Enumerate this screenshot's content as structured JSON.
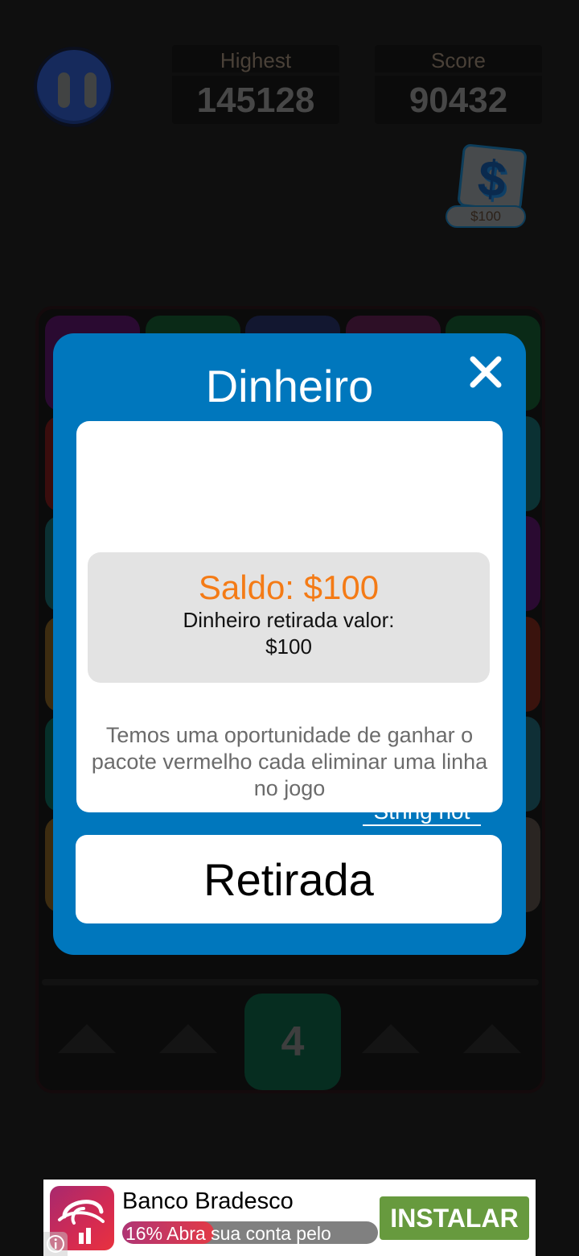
{
  "hud": {
    "pause_icon": "pause-icon",
    "highest": {
      "label": "Highest",
      "value": "145128"
    },
    "score": {
      "label": "Score",
      "value": "90432"
    },
    "money": {
      "icon": "dollar-icon",
      "amount": "$100"
    }
  },
  "board": {
    "tiles": [
      {
        "row": 0,
        "col": 0,
        "color": "#2a0a31",
        "value": ""
      },
      {
        "row": 0,
        "col": 1,
        "color": "#0a2a17",
        "value": ""
      },
      {
        "row": 0,
        "col": 2,
        "color": "#121730",
        "value": ""
      },
      {
        "row": 0,
        "col": 3,
        "color": "#2d0f26",
        "value": ""
      },
      {
        "row": 0,
        "col": 4,
        "color": "#0a2a17",
        "value": ""
      },
      {
        "row": 1,
        "col": 0,
        "color": "#3a0d0d",
        "value": ""
      },
      {
        "row": 1,
        "col": 4,
        "color": "#0b3133",
        "value": ""
      },
      {
        "row": 2,
        "col": 0,
        "color": "#0b3133",
        "value": ""
      },
      {
        "row": 2,
        "col": 4,
        "color": "#2a0a31",
        "value": ""
      },
      {
        "row": 3,
        "col": 0,
        "color": "#3d2c10",
        "value": ""
      },
      {
        "row": 3,
        "col": 4,
        "color": "#3a130d",
        "value": ""
      },
      {
        "row": 4,
        "col": 0,
        "color": "#06302a",
        "value": ""
      },
      {
        "row": 4,
        "col": 4,
        "color": "#0f2f36",
        "value": ""
      },
      {
        "row": 5,
        "col": 0,
        "color": "#3d2c10",
        "value": ""
      },
      {
        "row": 5,
        "col": 4,
        "color": "#2a2522",
        "value": ""
      }
    ],
    "next_tile": {
      "value": "4",
      "color": "#062d20"
    },
    "arrow_icon": "up-triangle-icon"
  },
  "modal": {
    "title": "Dinheiro",
    "close_icon": "close-icon",
    "balance": "Saldo: $100",
    "withdraw_label": "Dinheiro retirada valor:",
    "withdraw_value": "$100",
    "info": "Temos uma oportunidade de ganhar o pacote vermelho cada eliminar uma linha no jogo",
    "link_text": "String not",
    "withdraw_button": "Retirada",
    "colors": {
      "panel": "#0077bd",
      "balance": "#f47b16"
    }
  },
  "ad": {
    "app_name": "Banco Bradesco",
    "rating_percent": "16%",
    "progress_fraction": 0.16,
    "tagline": "Abra sua conta pelo",
    "install_label": "INSTALAR",
    "info_icon": "info-icon",
    "colors": {
      "install": "#679a3e"
    }
  }
}
